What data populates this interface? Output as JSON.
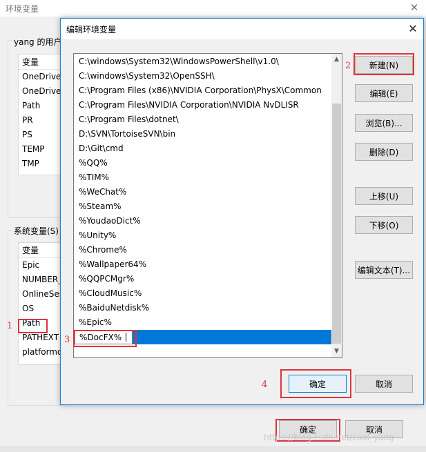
{
  "background_window": {
    "title": "环境变量",
    "close_glyph": "✕",
    "user_vars_group_label": "yang 的用户",
    "user_vars_table": {
      "header": "变量",
      "rows": [
        "OneDrive",
        "OneDrive",
        "Path",
        "PR",
        "PS",
        "TEMP",
        "TMP"
      ]
    },
    "system_vars_group_label": "系统变量(S)",
    "system_vars_table": {
      "header": "变量",
      "rows": [
        "Epic",
        "NUMBER_",
        "OnlineSer",
        "OS",
        "Path",
        "PATHEXT",
        "platformo"
      ]
    },
    "ok_label": "确定",
    "cancel_label": "取消"
  },
  "dialog": {
    "title": "编辑环境变量",
    "close_glyph": "✕",
    "path_entries": [
      "C:\\windows\\System32\\WindowsPowerShell\\v1.0\\",
      "C:\\windows\\System32\\OpenSSH\\",
      "C:\\Program Files (x86)\\NVIDIA Corporation\\PhysX\\Common",
      "C:\\Program Files\\NVIDIA Corporation\\NVIDIA NvDLISR",
      "C:\\Program Files\\dotnet\\",
      "D:\\SVN\\TortoiseSVN\\bin",
      "D:\\Git\\cmd",
      "%QQ%",
      "%TIM%",
      "%WeChat%",
      "%Steam%",
      "%YoudaoDict%",
      "%Unity%",
      "%Chrome%",
      "%Wallpaper64%",
      "%QQPCMgr%",
      "%CloudMusic%",
      "%BaiduNetdisk%",
      "%Epic%"
    ],
    "editing_entry": "%DocFX%",
    "buttons": {
      "new": "新建(N)",
      "edit": "编辑(E)",
      "browse": "浏览(B)...",
      "delete": "删除(D)",
      "move_up": "上移(U)",
      "move_down": "下移(O)",
      "edit_text": "编辑文本(T)...",
      "ok": "确定",
      "cancel": "取消"
    },
    "scroll_up_glyph": "▲",
    "scroll_down_glyph": "▼"
  },
  "annotations": {
    "step1": "1",
    "step2": "2",
    "step3": "3",
    "step4": "4",
    "highlight_color": "#e0333b"
  },
  "watermark": "https://blog.csdn.net/cool_yang"
}
